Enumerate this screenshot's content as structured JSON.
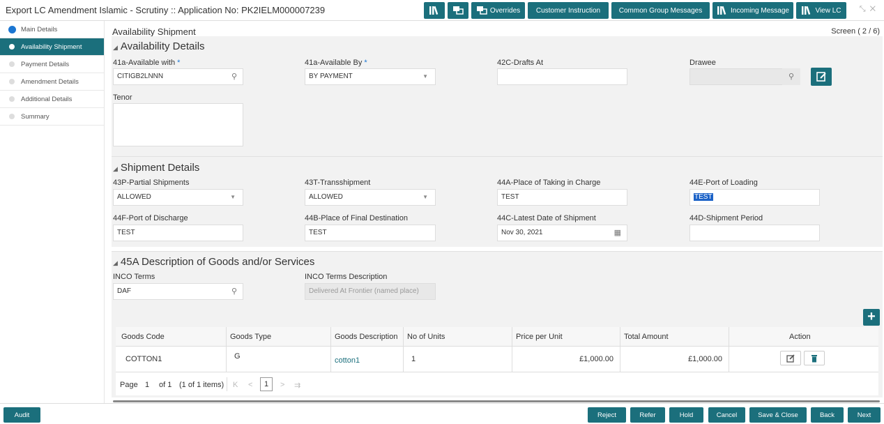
{
  "header": {
    "title": "Export LC Amendment Islamic - Scrutiny :: Application No: PK2IELM000007239",
    "buttons": {
      "overrides": "Overrides",
      "customer_instruction": "Customer Instruction",
      "common_group_messages": "Common Group Messages",
      "incoming_message": "Incoming Message",
      "view_lc": "View LC"
    }
  },
  "sidebar": {
    "items": [
      {
        "label": "Main Details"
      },
      {
        "label": "Availability Shipment"
      },
      {
        "label": "Payment Details"
      },
      {
        "label": "Amendment Details"
      },
      {
        "label": "Additional Details"
      },
      {
        "label": "Summary"
      }
    ]
  },
  "main": {
    "title": "Availability Shipment",
    "screen": "Screen ( 2 / 6)"
  },
  "availability": {
    "title": "Availability Details",
    "available_with": {
      "label": "41a-Available with",
      "value": "CITIGB2LNNN"
    },
    "available_by": {
      "label": "41a-Available By",
      "value": "BY PAYMENT"
    },
    "drafts_at": {
      "label": "42C-Drafts At",
      "value": ""
    },
    "drawee": {
      "label": "Drawee",
      "value": ""
    },
    "tenor": {
      "label": "Tenor",
      "value": ""
    },
    "required_mark": "*"
  },
  "shipment": {
    "title": "Shipment Details",
    "partial": {
      "label": "43P-Partial Shipments",
      "value": "ALLOWED"
    },
    "transshipment": {
      "label": "43T-Transshipment",
      "value": "ALLOWED"
    },
    "place_taking": {
      "label": "44A-Place of Taking in Charge",
      "value": "TEST"
    },
    "port_loading": {
      "label": "44E-Port of Loading",
      "value": "TEST"
    },
    "port_discharge": {
      "label": "44F-Port of Discharge",
      "value": "TEST"
    },
    "final_destination": {
      "label": "44B-Place of Final Destination",
      "value": "TEST"
    },
    "latest_date": {
      "label": "44C-Latest Date of Shipment",
      "value": "Nov 30, 2021"
    },
    "shipment_period": {
      "label": "44D-Shipment Period",
      "value": ""
    }
  },
  "goods": {
    "title": "45A Description of Goods and/or Services",
    "inco_terms": {
      "label": "INCO Terms",
      "value": "DAF"
    },
    "inco_desc": {
      "label": "INCO Terms Description",
      "value": "Delivered At Frontier (named place)"
    },
    "table": {
      "headers": [
        "Goods Code",
        "Goods Type",
        "Goods Description",
        "No of Units",
        "Price per Unit",
        "Total Amount",
        "Action"
      ],
      "rows": [
        {
          "code": "COTTON1",
          "type": "G",
          "description": "cotton1",
          "units": "1",
          "price": "£1,000.00",
          "total": "£1,000.00"
        }
      ]
    },
    "pager": {
      "page_label": "Page",
      "page": "1",
      "of": "of 1",
      "items": "(1 of 1 items)",
      "current": "1"
    }
  },
  "footer": {
    "audit": "Audit",
    "reject": "Reject",
    "refer": "Refer",
    "hold": "Hold",
    "cancel": "Cancel",
    "save_close": "Save & Close",
    "back": "Back",
    "next": "Next"
  },
  "colors": {
    "accent": "#1b6f7c",
    "link": "#1b76d2"
  }
}
